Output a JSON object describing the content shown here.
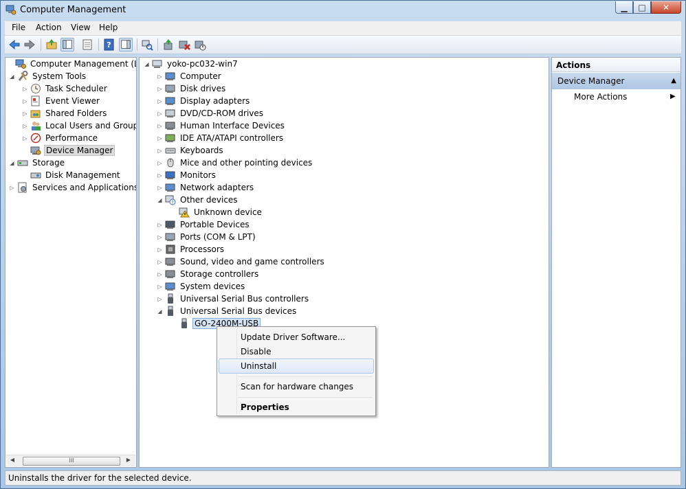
{
  "window": {
    "title": "Computer Management"
  },
  "menubar": {
    "items": [
      "File",
      "Action",
      "View",
      "Help"
    ]
  },
  "toolbar": {
    "icons": [
      "back-arrow-icon",
      "forward-arrow-icon",
      "up-folder-icon",
      "show-hide-tree-icon",
      "properties-icon",
      "help-icon",
      "show-hide-action-pane-icon",
      "scan-hardware-icon",
      "update-driver-icon",
      "uninstall-device-icon",
      "disable-device-icon"
    ]
  },
  "left_tree": {
    "items": [
      {
        "label": "Computer Management (Local)",
        "icon": "computer-management-icon",
        "level": 0,
        "expander": ""
      },
      {
        "label": "System Tools",
        "icon": "system-tools-icon",
        "level": 1,
        "expander": "◢"
      },
      {
        "label": "Task Scheduler",
        "icon": "clock-icon",
        "level": 2,
        "expander": "▷"
      },
      {
        "label": "Event Viewer",
        "icon": "event-viewer-icon",
        "level": 2,
        "expander": "▷"
      },
      {
        "label": "Shared Folders",
        "icon": "shared-folder-icon",
        "level": 2,
        "expander": "▷"
      },
      {
        "label": "Local Users and Groups",
        "icon": "users-icon",
        "level": 2,
        "expander": "▷"
      },
      {
        "label": "Performance",
        "icon": "performance-icon",
        "level": 2,
        "expander": "▷"
      },
      {
        "label": "Device Manager",
        "icon": "device-manager-icon",
        "level": 2,
        "expander": "",
        "selected": true
      },
      {
        "label": "Storage",
        "icon": "storage-icon",
        "level": 1,
        "expander": "◢"
      },
      {
        "label": "Disk Management",
        "icon": "disk-management-icon",
        "level": 2,
        "expander": ""
      },
      {
        "label": "Services and Applications",
        "icon": "services-icon",
        "level": 1,
        "expander": "▷"
      }
    ],
    "scroll_thumb": "III"
  },
  "device_tree": {
    "root": "yoko-pc032-win7",
    "categories": [
      {
        "label": "Computer",
        "icon": "computer-icon",
        "expander": "▷"
      },
      {
        "label": "Disk drives",
        "icon": "disk-drive-icon",
        "expander": "▷"
      },
      {
        "label": "Display adapters",
        "icon": "display-adapter-icon",
        "expander": "▷"
      },
      {
        "label": "DVD/CD-ROM drives",
        "icon": "dvd-drive-icon",
        "expander": "▷"
      },
      {
        "label": "Human Interface Devices",
        "icon": "hid-icon",
        "expander": "▷"
      },
      {
        "label": "IDE ATA/ATAPI controllers",
        "icon": "ide-controller-icon",
        "expander": "▷"
      },
      {
        "label": "Keyboards",
        "icon": "keyboard-icon",
        "expander": "▷"
      },
      {
        "label": "Mice and other pointing devices",
        "icon": "mouse-icon",
        "expander": "▷"
      },
      {
        "label": "Monitors",
        "icon": "monitor-icon",
        "expander": "▷"
      },
      {
        "label": "Network adapters",
        "icon": "network-adapter-icon",
        "expander": "▷"
      },
      {
        "label": "Other devices",
        "icon": "other-devices-icon",
        "expander": "◢"
      },
      {
        "label": "Unknown device",
        "icon": "warning-device-icon",
        "expander": "",
        "child": true
      },
      {
        "label": "Portable Devices",
        "icon": "portable-device-icon",
        "expander": "▷"
      },
      {
        "label": "Ports (COM & LPT)",
        "icon": "port-icon",
        "expander": "▷"
      },
      {
        "label": "Processors",
        "icon": "processor-icon",
        "expander": "▷"
      },
      {
        "label": "Sound, video and game controllers",
        "icon": "sound-icon",
        "expander": "▷"
      },
      {
        "label": "Storage controllers",
        "icon": "storage-controller-icon",
        "expander": "▷"
      },
      {
        "label": "System devices",
        "icon": "system-devices-icon",
        "expander": "▷"
      },
      {
        "label": "Universal Serial Bus controllers",
        "icon": "usb-icon",
        "expander": "▷"
      },
      {
        "label": "Universal Serial Bus devices",
        "icon": "usb-icon",
        "expander": "◢"
      },
      {
        "label": "GO-2400M-USB",
        "icon": "usb-icon",
        "expander": "",
        "child": true,
        "selected": true
      }
    ]
  },
  "actions": {
    "header": "Actions",
    "section": "Device Manager",
    "items": [
      "More Actions"
    ]
  },
  "context_menu": {
    "items": [
      {
        "label": "Update Driver Software..."
      },
      {
        "label": "Disable"
      },
      {
        "label": "Uninstall",
        "hover": true
      },
      {
        "label": "Scan for hardware changes"
      },
      {
        "label": "Properties",
        "bold": true
      }
    ]
  },
  "statusbar": {
    "text": "Uninstalls the driver for the selected device."
  },
  "colors": {
    "selection_blue": "#d5e4f5",
    "title_gradient_top": "#c8dcf0",
    "close_red": "#c7452b"
  }
}
